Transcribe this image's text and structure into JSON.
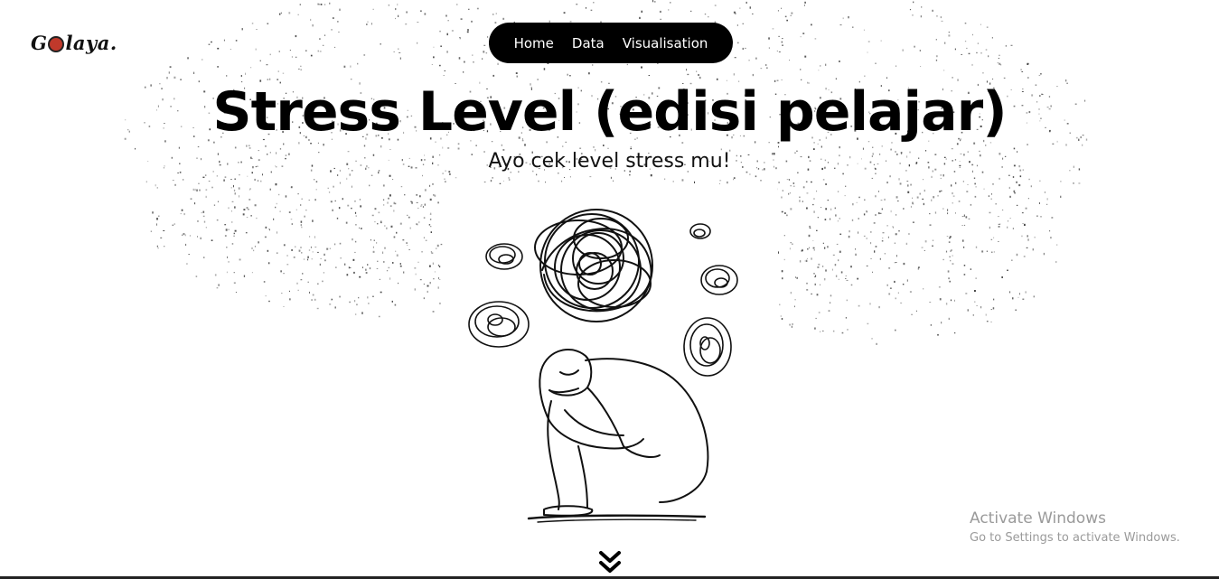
{
  "logo": {
    "text_before": "G",
    "text_after": "laya."
  },
  "nav": {
    "items": [
      {
        "label": "Home"
      },
      {
        "label": "Data"
      },
      {
        "label": "Visualisation"
      }
    ]
  },
  "hero": {
    "title": "Stress Level (edisi pelajar)",
    "subtitle": "Ayo cek level stress mu!"
  },
  "illustration": {
    "icon": "stressed-person-illustration"
  },
  "scroll": {
    "icon": "double-chevron-down-icon"
  },
  "watermark": {
    "title": "Activate Windows",
    "subtitle": "Go to Settings to activate Windows."
  },
  "colors": {
    "background": "#ffffff",
    "nav_background": "#000000",
    "nav_text": "#ffffff",
    "text": "#000000",
    "watermark": "#9a9a9a",
    "logo_accent": "#c0392b"
  }
}
